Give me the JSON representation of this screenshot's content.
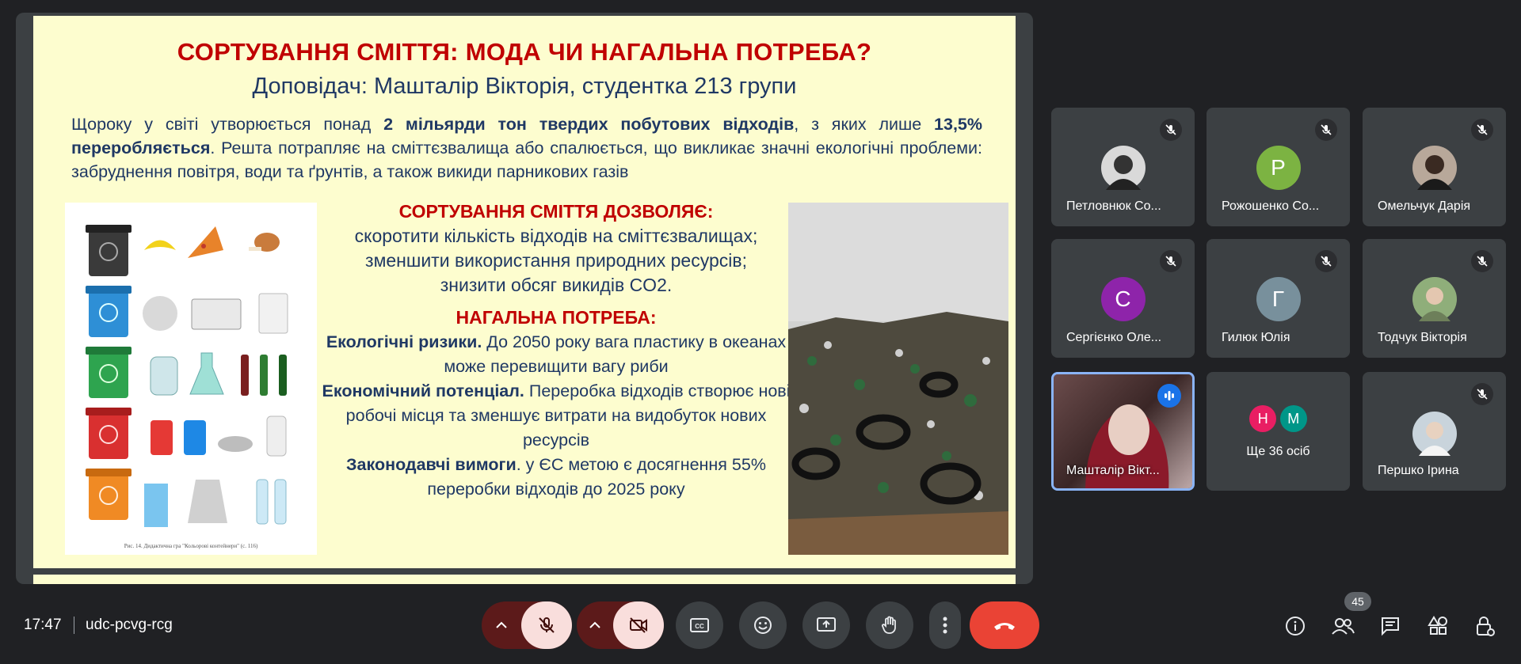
{
  "slide": {
    "title": "СОРТУВАННЯ СМІТТЯ: МОДА ЧИ НАГАЛЬНА ПОТРЕБА?",
    "subtitle": "Доповідач: Машталір Вікторія, студентка 213 групи",
    "intro_1": "Щороку у світі утворюється понад ",
    "intro_b1": "2 мільярди тон твердих побутових відходів",
    "intro_2": ", з яких лише ",
    "intro_b2": "13,5% переробляється",
    "intro_3": ". Решта потрапляє на сміттєзвалища або спалюється, що викликає значні екологічні проблеми: забруднення повітря, води та ґрунтів, а також викиди парникових газів",
    "allows_heading": "СОРТУВАННЯ СМІТТЯ ДОЗВОЛЯЄ:",
    "allows_1": "скоротити кількість відходів на сміттєзвалищах;",
    "allows_2": "зменшити використання природних ресурсів;",
    "allows_3": "знизити обсяг викидів CO2.",
    "need_heading": "НАГАЛЬНА ПОТРЕБА:",
    "eco_b": "Екологічні ризики.",
    "eco_t": " До 2050 року вага пластику в океанах може перевищити вагу риби",
    "econ_b": "Економічний потенціал.",
    "econ_t": " Переробка відходів створює нові робочі місця та зменшує витрати на видобуток нових ресурсів",
    "law_b": "Законодавчі вимоги",
    "law_t": ". у ЄС метою є досягнення 55% переробки відходів до 2025 року",
    "caption": "Рис. 14. Дидактична гра \"Кольорові контейнери\" (с. 116)"
  },
  "participants": [
    {
      "name": "Петловнюк Со...",
      "avatar": "photo",
      "color": "#cfcfcf"
    },
    {
      "name": "Рожошенко Со...",
      "avatar": "P",
      "color": "#7cb342"
    },
    {
      "name": "Омельчук Дарія",
      "avatar": "photo",
      "color": "#b8a89a"
    },
    {
      "name": "Сергієнко Оле...",
      "avatar": "C",
      "color": "#8e24aa"
    },
    {
      "name": "Гилюк Юлія",
      "avatar": "Г",
      "color": "#78909c"
    },
    {
      "name": "Тодчук Вікторія",
      "avatar": "photo",
      "color": "#8fae7a"
    },
    {
      "name": "Машталір Вікт...",
      "avatar": "video",
      "color": "#5a3d3d"
    },
    {
      "name": "Ще 36 осіб",
      "avatar": "group",
      "color": "#3c4043",
      "mini": [
        "Н",
        "М"
      ]
    },
    {
      "name": "Першко Ірина",
      "avatar": "photo",
      "color": "#c9d4dc"
    }
  ],
  "bottom": {
    "time": "17:47",
    "meeting_code": "udc-pcvg-rcg",
    "people_count": "45"
  },
  "colors": {
    "bg": "#202124",
    "tile": "#3c4043",
    "hangup": "#ea4335",
    "mic_off_bg": "#f9dedc",
    "slide_bg": "#fdfdcf",
    "slide_red": "#c00000",
    "slide_blue": "#1f3864"
  }
}
